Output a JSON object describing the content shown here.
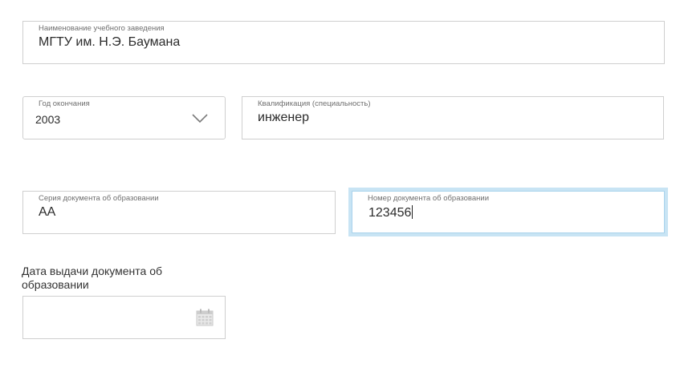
{
  "institution": {
    "label": "Наименование учебного заведения",
    "value": "МГТУ им. Н.Э. Баумана"
  },
  "graduation_year": {
    "label": "Год окончания",
    "value": "2003"
  },
  "qualification": {
    "label": "Квалификация (специальность)",
    "value": "инженер"
  },
  "doc_series": {
    "label": "Серия документа об образовании",
    "value": "АА"
  },
  "doc_number": {
    "label": "Номер документа об образовании",
    "value": "123456"
  },
  "issue_date": {
    "label_line1": "Дата выдачи документа об",
    "label_line2": "образовании",
    "value": ""
  },
  "icons": {
    "dropdown": "chevron-down-icon",
    "date_picker": "calendar-icon"
  },
  "colors": {
    "focus_border": "#c8e4f4",
    "border": "#cfcfcf",
    "label": "#6f6f6f"
  }
}
